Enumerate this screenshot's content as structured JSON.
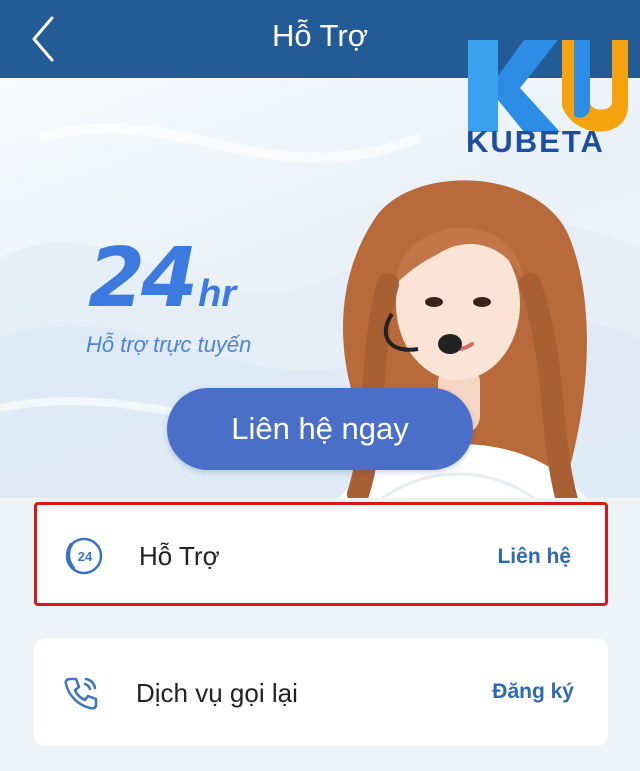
{
  "header": {
    "title": "Hỗ Trợ"
  },
  "logo": {
    "brand": "KUBETA",
    "mark": "KU"
  },
  "hero": {
    "badge_number": "24",
    "badge_unit": "hr",
    "subtitle": "Hỗ trợ trực tuyến",
    "cta_label": "Liên hệ ngay"
  },
  "options": [
    {
      "icon": "24h-phone-icon",
      "label": "Hỗ Trợ",
      "action": "Liên hệ"
    },
    {
      "icon": "phone-callback-icon",
      "label": "Dịch vụ gọi lại",
      "action": "Đăng ký"
    }
  ],
  "colors": {
    "header": "#235b96",
    "accent": "#4a6fc9",
    "highlight_border": "#d7161e",
    "action_text": "#2f69b4"
  }
}
